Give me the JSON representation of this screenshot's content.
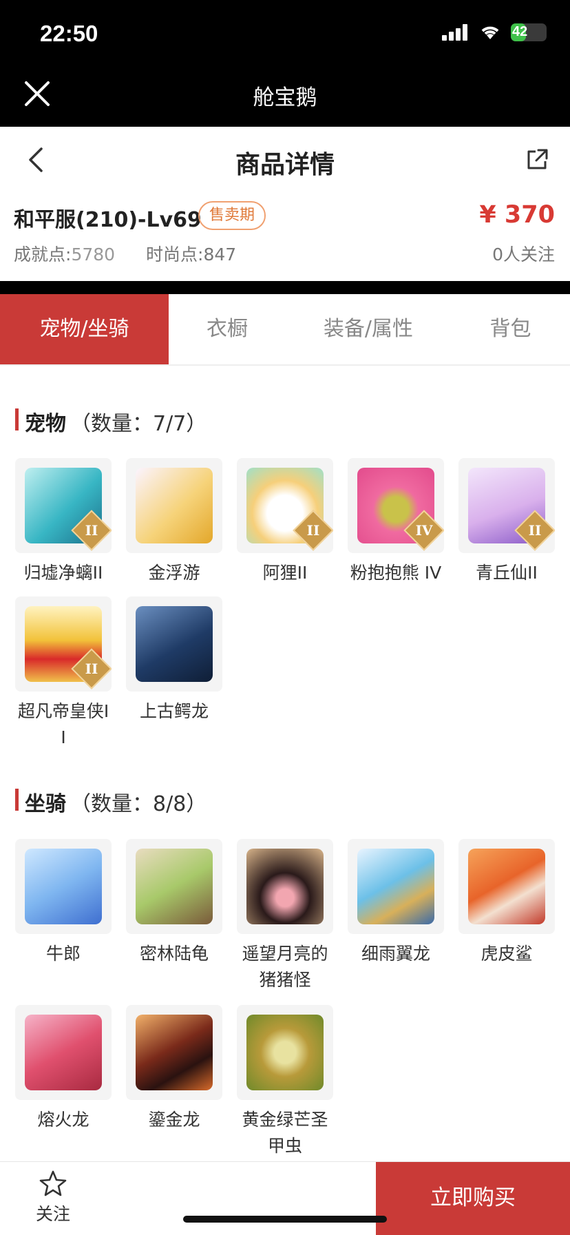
{
  "status_bar": {
    "time": "22:50",
    "battery": "42"
  },
  "app_bar": {
    "title": "舱宝鹅"
  },
  "header": {
    "title": "商品详情"
  },
  "product": {
    "server_level": "和平服(210)-Lv69",
    "badge": "售卖期",
    "price": "¥ 370",
    "achievement_label": "成就点:",
    "achievement_value": "5780",
    "fashion_label": "时尚点:",
    "fashion_value": "847",
    "followers": "0人关注"
  },
  "tabs": [
    "宠物/坐骑",
    "衣橱",
    "装备/属性",
    "背包"
  ],
  "pets": {
    "title": "宠物",
    "count": "（数量：7/7）",
    "items": [
      {
        "name": "归墟净螭II",
        "tier": "II"
      },
      {
        "name": "金浮游",
        "tier": ""
      },
      {
        "name": "阿狸II",
        "tier": "II"
      },
      {
        "name": "粉抱抱熊 IV",
        "tier": "IV"
      },
      {
        "name": "青丘仙II",
        "tier": "II"
      },
      {
        "name": "超凡帝皇侠II",
        "tier": "II"
      },
      {
        "name": "上古鳄龙",
        "tier": ""
      }
    ]
  },
  "mounts": {
    "title": "坐骑",
    "count": "（数量：8/8）",
    "items": [
      {
        "name": "牛郎"
      },
      {
        "name": "密林陆龟"
      },
      {
        "name": "遥望月亮的猪猪怪"
      },
      {
        "name": "细雨翼龙"
      },
      {
        "name": "虎皮鲨"
      },
      {
        "name": "熔火龙"
      },
      {
        "name": "鎏金龙"
      },
      {
        "name": "黄金绿芒圣甲虫"
      }
    ]
  },
  "bottom_bar": {
    "follow_label": "关注",
    "buy_label": "立即购买"
  },
  "colors": {
    "accent": "#c93a37",
    "price": "#d83a34",
    "badge": "#e07a3a"
  }
}
